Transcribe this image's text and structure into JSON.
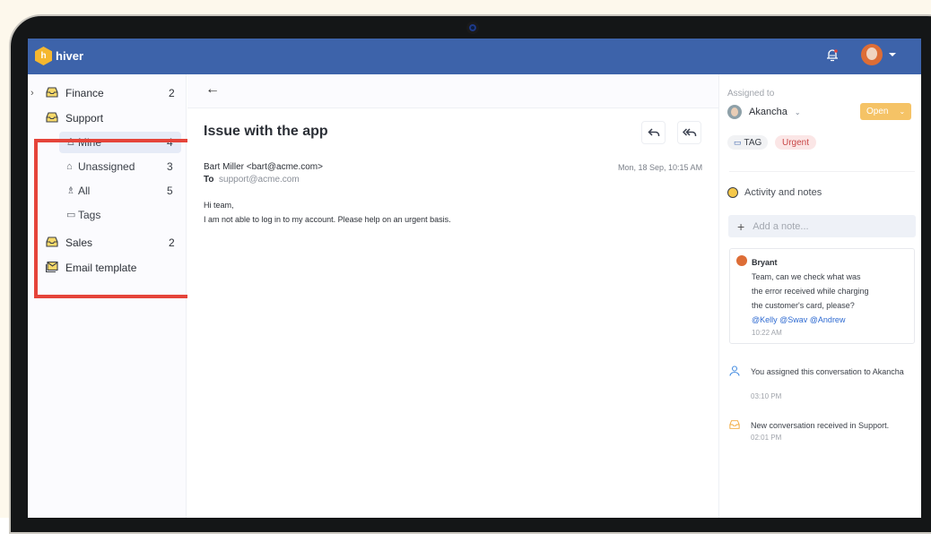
{
  "app": {
    "name": "hiver",
    "logo_glyph": "h",
    "icons": {
      "notification": "bell-icon",
      "user": "user-avatar",
      "user_menu": "caret-down-icon"
    }
  },
  "sidebar": {
    "groups": [
      {
        "label": "Finance",
        "count": "2",
        "icon": "inbox-icon",
        "expander": "›"
      },
      {
        "label": "Support",
        "count": "",
        "icon": "inbox-icon",
        "children": [
          {
            "label": "Mine",
            "count": "4",
            "icon": "user-icon",
            "glyph": "♙",
            "active": true
          },
          {
            "label": "Unassigned",
            "count": "3",
            "icon": "unassigned-icon",
            "glyph": "⌂",
            "active": false
          },
          {
            "label": "All",
            "count": "5",
            "icon": "users-icon",
            "glyph": "♗",
            "active": false
          },
          {
            "label": "Tags",
            "count": "",
            "icon": "tag-icon",
            "glyph": "▭",
            "active": false
          }
        ]
      },
      {
        "label": "Sales",
        "count": "2",
        "icon": "inbox-icon"
      },
      {
        "label": "Email template",
        "count": "",
        "icon": "email-template-icon"
      }
    ]
  },
  "conversation": {
    "back_glyph": "←",
    "subject": "Issue with the app",
    "reply_glyph": "↰",
    "reply_all_glyph": "⇇",
    "from": "Bart Miller <bart@acme.com>",
    "to_label": "To",
    "to": "support@acme.com",
    "date": "Mon, 18 Sep, 10:15 AM",
    "body": [
      "Hi team,",
      "I am not able to log in to my account. Please help on an urgent basis."
    ]
  },
  "details": {
    "assigned_label": "Assigned to",
    "assignee": "Akancha",
    "chevron": "⌄",
    "status": "Open",
    "status_color": "#f5c366",
    "tags": [
      {
        "label": "TAG",
        "glyph": "▭"
      },
      {
        "label": "Urgent",
        "color": "#c94747"
      }
    ],
    "activity_title": "Activity and notes",
    "note_placeholder": "Add a note...",
    "note_plus": "+",
    "notes": [
      {
        "author": "Bryant",
        "lines": [
          "Team, can we check what was",
          "the error received while charging",
          "the customer's card, please?"
        ],
        "mentions": "@Kelly @Swav @Andrew",
        "time": "10:22 AM"
      }
    ],
    "activity": [
      {
        "icon": "user-assign-icon",
        "text": "You assigned this conversation to Akancha",
        "time": "03:10 PM"
      },
      {
        "icon": "inbox-icon",
        "text": "New conversation received in Support.",
        "time": "02:01 PM"
      }
    ]
  }
}
